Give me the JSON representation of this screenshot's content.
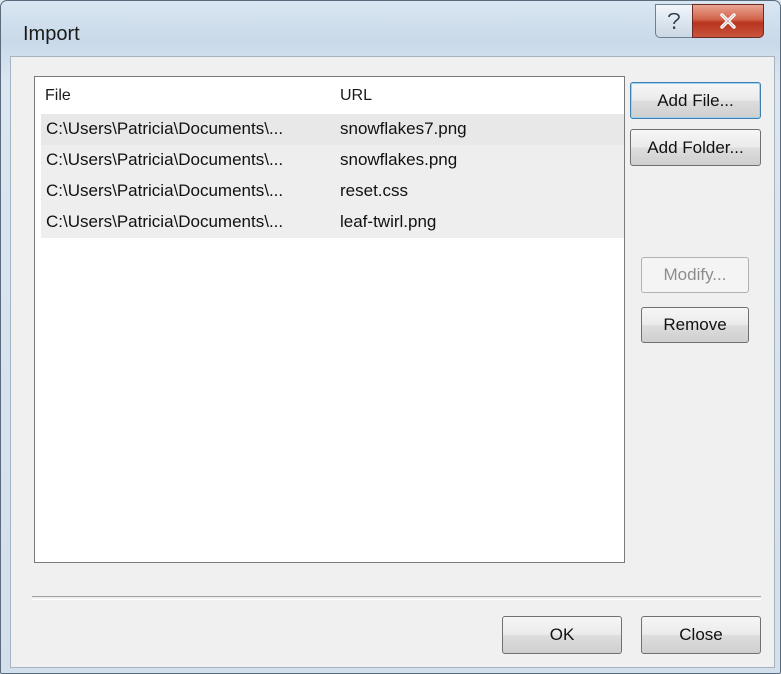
{
  "window": {
    "title": "Import",
    "help_glyph": "?",
    "close_glyph": "X"
  },
  "list": {
    "columns": [
      "File",
      "URL"
    ],
    "rows": [
      {
        "file": "C:\\Users\\Patricia\\Documents\\...",
        "url": "snowflakes7.png"
      },
      {
        "file": "C:\\Users\\Patricia\\Documents\\...",
        "url": "snowflakes.png"
      },
      {
        "file": "C:\\Users\\Patricia\\Documents\\...",
        "url": "reset.css"
      },
      {
        "file": "C:\\Users\\Patricia\\Documents\\...",
        "url": "leaf-twirl.png"
      }
    ]
  },
  "buttons": {
    "add_file": "Add File...",
    "add_folder": "Add Folder...",
    "modify": "Modify...",
    "remove": "Remove",
    "ok": "OK",
    "close": "Close"
  },
  "icons": {
    "help": "help-icon",
    "close": "close-icon"
  },
  "colors": {
    "close_button": "#c8553c",
    "default_button_border": "#3c7fb1"
  }
}
